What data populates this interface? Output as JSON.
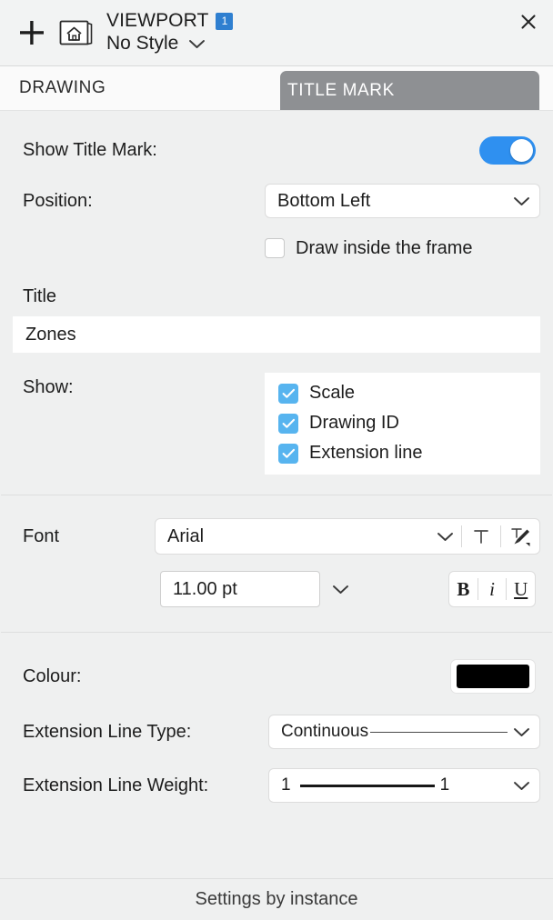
{
  "header": {
    "add_icon": "plus-icon",
    "viewport_icon": "viewport-house-icon",
    "title": "VIEWPORT",
    "badge": "1",
    "style": "No Style",
    "style_chevron_icon": "chevron-down-icon",
    "close_icon": "close-icon"
  },
  "tabs": [
    {
      "label": "DRAWING",
      "active": false
    },
    {
      "label": "TITLE MARK",
      "active": true
    }
  ],
  "show_title_mark": {
    "label": "Show Title Mark:",
    "value": "on"
  },
  "position": {
    "label": "Position:",
    "value": "Bottom Left",
    "chevron_icon": "chevron-down-icon"
  },
  "draw_inside": {
    "label": "Draw inside the frame",
    "checked": false
  },
  "title": {
    "label": "Title",
    "value": "Zones",
    "placeholder": "Title"
  },
  "show": {
    "label": "Show:",
    "items": [
      {
        "label": "Scale",
        "checked": true
      },
      {
        "label": "Drawing ID",
        "checked": true
      },
      {
        "label": "Extension line",
        "checked": true
      }
    ]
  },
  "font": {
    "label": "Font",
    "family": "Arial",
    "family_chevron_icon": "chevron-down-icon",
    "text_icon": "text-T-icon",
    "text_style_icon": "text-brush-icon",
    "size": "11.00 pt",
    "size_chevron_icon": "chevron-down-icon",
    "bold_label": "B",
    "italic_label": "i",
    "underline_label": "U"
  },
  "colour": {
    "label": "Colour:",
    "value": "#000000"
  },
  "extension_line_type": {
    "label": "Extension Line Type:",
    "value": "Continuous",
    "chevron_icon": "chevron-down-icon"
  },
  "extension_line_weight": {
    "label": "Extension Line Weight:",
    "value_left": "1",
    "value_right": "1",
    "chevron_icon": "chevron-down-icon"
  },
  "footer": {
    "label": "Settings by instance"
  },
  "colors": {
    "accent_blue": "#2f90f0",
    "checkbox_blue": "#57b4ef",
    "badge_blue": "#2f7fd0",
    "active_tab_gray": "#8e9093",
    "panel_bg": "#eff0f0"
  }
}
